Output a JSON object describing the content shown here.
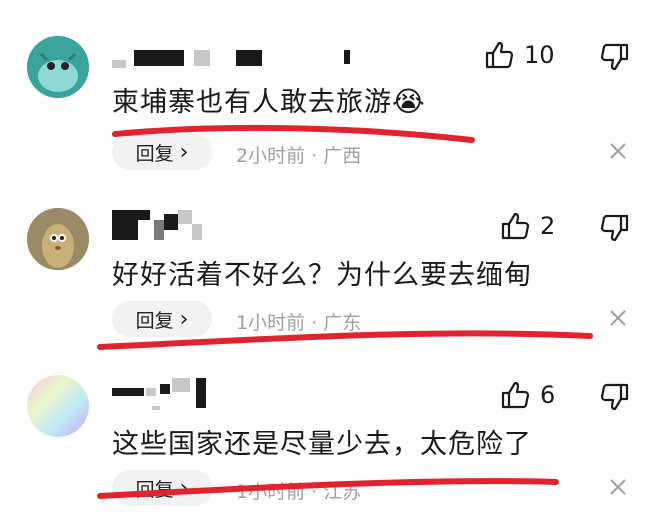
{
  "comments": [
    {
      "text": "柬埔寨也有人敢去旅游",
      "emoji": "😭",
      "likes": "10",
      "reply_label": "回复",
      "reply_chevron": "›",
      "meta": "2小时前 · 广西",
      "avatar_icon": "teal-monster-avatar-icon"
    },
    {
      "text": "好好活着不好么？为什么要去缅甸",
      "likes": "2",
      "reply_label": "回复",
      "reply_chevron": "›",
      "meta": "1小时前 · 广东",
      "avatar_icon": "tan-character-avatar-icon"
    },
    {
      "text": "这些国家还是尽量少去，太危险了",
      "likes": "6",
      "reply_label": "回复",
      "reply_chevron": "›",
      "meta": "1小时前 · 江苏",
      "avatar_icon": "holographic-gradient-avatar-icon"
    }
  ],
  "colors": {
    "annotation_red": "#e0232d",
    "meta_gray": "#a0a0a0",
    "reply_bg": "#f2f2f2",
    "avatar1_bg": "#39a39c",
    "avatar2_bg": "#9a8a66"
  },
  "icons": [
    "thumbs-up-icon",
    "thumbs-down-icon",
    "close-icon",
    "crying-laughing-emoji-icon"
  ]
}
